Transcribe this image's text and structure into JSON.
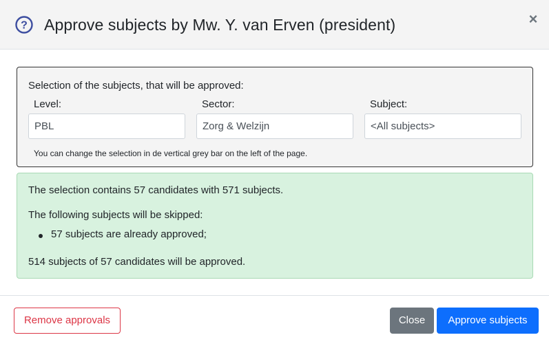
{
  "header": {
    "title": "Approve subjects by Mw. Y. van Erven (president)",
    "close_symbol": "×",
    "help_icon_symbol": "?",
    "help_icon_color": "#3d4ea0"
  },
  "selection": {
    "title": "Selection of the subjects, that will be approved:",
    "level": {
      "label": "Level:",
      "value": "PBL"
    },
    "sector": {
      "label": "Sector:",
      "value": "Zorg & Welzijn"
    },
    "subject": {
      "label": "Subject:",
      "value": "<All subjects>"
    },
    "hint": "You can change the selection in de vertical grey bar on the left of the page."
  },
  "info": {
    "contains": "The selection contains 57 candidates with 571 subjects.",
    "skipped_intro": "The following subjects will be skipped:",
    "skipped_items": [
      "57 subjects are already approved;"
    ],
    "result": "514 subjects of 57 candidates will be approved."
  },
  "footer": {
    "remove_label": "Remove approvals",
    "close_label": "Close",
    "approve_label": "Approve subjects"
  },
  "colors": {
    "danger": "#dc3545",
    "secondary": "#6c757d",
    "primary": "#0d6efd",
    "success_bg": "#d8f2df"
  }
}
